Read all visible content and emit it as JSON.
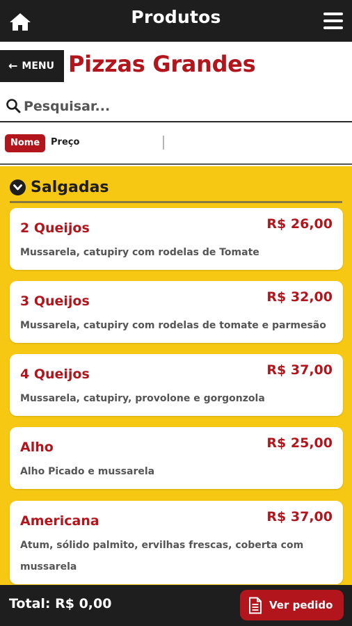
{
  "topbar": {
    "title": "Produtos",
    "home_icon": "home-icon",
    "menu_icon": "hamburger-menu-icon"
  },
  "header": {
    "menu_label": "MENU",
    "page_title": "Pizzas Grandes"
  },
  "search": {
    "placeholder": "Pesquisar..."
  },
  "sort": {
    "options": [
      "Nome",
      "Preço"
    ],
    "selected": "Nome"
  },
  "category": {
    "name": "Salgadas"
  },
  "products": [
    {
      "name": "2 Queijos",
      "price": "R$ 26,00",
      "description": "Mussarela, catupiry com rodelas de Tomate"
    },
    {
      "name": "3 Queijos",
      "price": "R$ 32,00",
      "description": "Mussarela, catupiry com rodelas de tomate e parmesão"
    },
    {
      "name": "4 Queijos",
      "price": "R$ 37,00",
      "description": "Mussarela, catupiry, provolone e gorgonzola"
    },
    {
      "name": "Alho",
      "price": "R$ 25,00",
      "description": "Alho Picado e mussarela"
    },
    {
      "name": "Americana",
      "price": "R$ 37,00",
      "description": "Atum, sólido palmito, ervilhas frescas, coberta com mussarela"
    }
  ],
  "footer": {
    "total": "Total: R$ 0,00",
    "order_label": "Ver pedido"
  },
  "colors": {
    "accent_red": "#b3151c",
    "dark_bar": "#1e1e1e",
    "list_background": "#f7c813"
  }
}
